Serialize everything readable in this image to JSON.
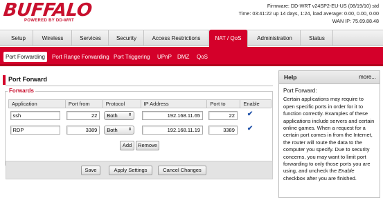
{
  "header": {
    "logo_text": "BUFFALO",
    "logo_sub": "POWERED BY DD-WRT",
    "firmware": "Firmware: DD-WRT v24SP2-EU-US (08/19/10) std",
    "time": "Time: 03:41:22 up 14 days, 1:24, load average: 0.00, 0.00, 0.00",
    "wan_ip": "WAN IP: 75.69.88.48"
  },
  "main_tabs": [
    "Setup",
    "Wireless",
    "Services",
    "Security",
    "Access Restrictions",
    "NAT / QoS",
    "Administration",
    "Status"
  ],
  "sub_tabs": [
    "Port Forwarding",
    "Port Range Forwarding",
    "Port Triggering",
    "UPnP",
    "DMZ",
    "QoS"
  ],
  "section_title": "Port Forward",
  "forwards": {
    "legend": "Forwards",
    "columns": [
      "Application",
      "Port from",
      "Protocol",
      "IP Address",
      "Port to",
      "Enable"
    ],
    "rows": [
      {
        "application": "ssh",
        "port_from": "22",
        "protocol": "Both",
        "ip": "192.168.11.65",
        "port_to": "22",
        "enabled": true
      },
      {
        "application": "RDP",
        "port_from": "3389",
        "protocol": "Both",
        "ip": "192.168.11.19",
        "port_to": "3389",
        "enabled": true
      }
    ],
    "add_label": "Add",
    "remove_label": "Remove"
  },
  "actions": {
    "save": "Save",
    "apply": "Apply Settings",
    "cancel": "Cancel Changes"
  },
  "help": {
    "title": "Help",
    "more": "more...",
    "subtitle": "Port Forward:",
    "text_a": "Certain applications may require to open specific ports in order for it to function correctly. Examples of these applications include servers and certain online games. When a request for a certain port comes in from the Internet, the router will route the data to the computer you specify. Due to security concerns, you may want to limit port forwarding to only those ports you are using, and uncheck the",
    "text_em": "Enable",
    "text_b": "checkbox after you are finished."
  },
  "colors": {
    "brand_red": "#d4002a",
    "checkbox_blue": "#1d4fa8"
  }
}
